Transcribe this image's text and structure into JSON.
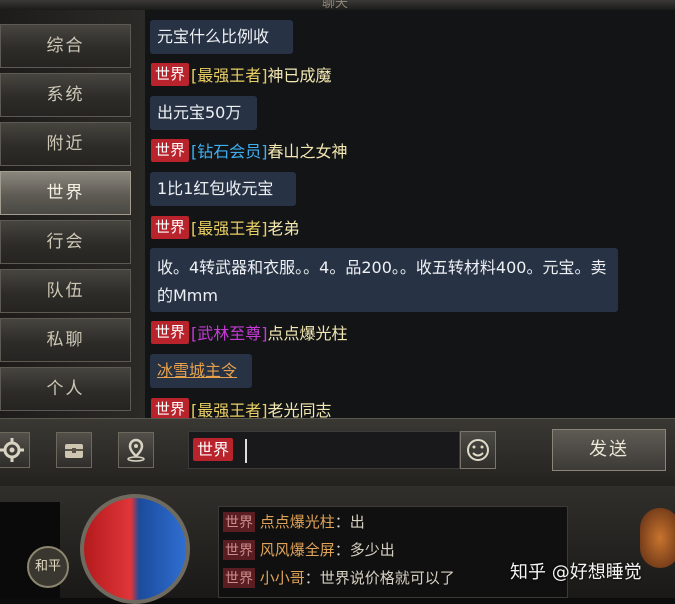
{
  "window": {
    "title": "聊天"
  },
  "tabs": [
    {
      "label": "综合",
      "active": false
    },
    {
      "label": "系统",
      "active": false
    },
    {
      "label": "附近",
      "active": false
    },
    {
      "label": "世界",
      "active": true
    },
    {
      "label": "行会",
      "active": false
    },
    {
      "label": "队伍",
      "active": false
    },
    {
      "label": "私聊",
      "active": false
    },
    {
      "label": "个人",
      "active": false
    }
  ],
  "messages": [
    {
      "type": "bubble",
      "text": "元宝什么比例收"
    },
    {
      "type": "header",
      "channel": "世界",
      "rank": "[最强王者]",
      "rank_color": "#e9cf63",
      "name": "神已成魔"
    },
    {
      "type": "bubble",
      "text": "出元宝50万"
    },
    {
      "type": "header",
      "channel": "世界",
      "rank": "[钻石会员]",
      "rank_color": "#3db0f4",
      "name": "春山之女神"
    },
    {
      "type": "bubble",
      "text": "1比1红包收元宝"
    },
    {
      "type": "header",
      "channel": "世界",
      "rank": "[最强王者]",
      "rank_color": "#e9cf63",
      "name": "老弟"
    },
    {
      "type": "bubble",
      "text": "收。4转武器和衣服。。4。品200。。收五转材料400。元宝。卖的Mmm"
    },
    {
      "type": "header",
      "channel": "世界",
      "rank": "[武林至尊]",
      "rank_color": "#c63ad6",
      "name": "点点爆光柱"
    },
    {
      "type": "bubble",
      "text": "冰雪城主令"
    },
    {
      "type": "header",
      "channel": "世界",
      "rank": "[最强王者]",
      "rank_color": "#e9cf63",
      "name": "老光同志"
    }
  ],
  "input": {
    "channel": "世界",
    "value": ""
  },
  "send_label": "发送",
  "mini_chat": [
    {
      "channel": "世界",
      "name": "点点爆光柱",
      "text": "：出"
    },
    {
      "channel": "世界",
      "name": "风风爆全屏",
      "text": "：多少出"
    },
    {
      "channel": "世界",
      "name": "小小哥",
      "text": "：世界说价格就可以了"
    }
  ],
  "hud": {
    "mode_label": "和平"
  },
  "watermark": "知乎 @好想睡觉",
  "icons": [
    "gear-icon",
    "chest-icon",
    "location-pin-icon",
    "smiley-icon"
  ]
}
